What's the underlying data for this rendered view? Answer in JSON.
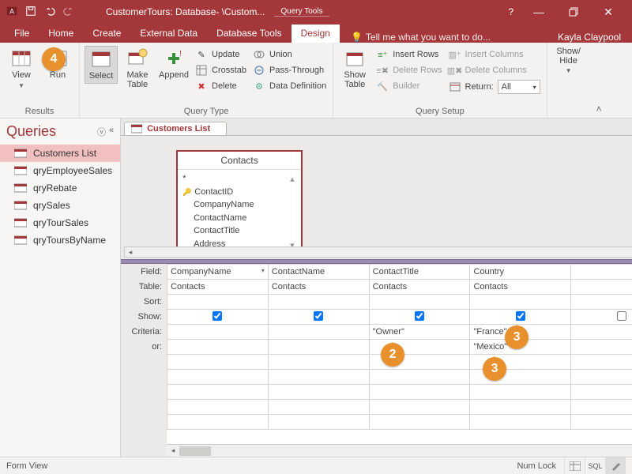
{
  "titlebar": {
    "app_title": "CustomerTours: Database- \\Custom...",
    "query_tools": "Query Tools",
    "help": "?"
  },
  "tabs": {
    "file": "File",
    "home": "Home",
    "create": "Create",
    "external": "External Data",
    "dbtools": "Database Tools",
    "design": "Design",
    "tellme": "Tell me what you want to do...",
    "user": "Kayla Claypool"
  },
  "ribbon": {
    "results": {
      "label": "Results",
      "view": "View",
      "run": "Run"
    },
    "qtype": {
      "label": "Query Type",
      "select": "Select",
      "maketable": "Make\nTable",
      "append": "Append",
      "update": "Update",
      "crosstab": "Crosstab",
      "delete": "Delete",
      "union": "Union",
      "passthrough": "Pass-Through",
      "datadef": "Data Definition"
    },
    "setup": {
      "label": "Query Setup",
      "showtable": "Show\nTable",
      "insrows": "Insert Rows",
      "delrows": "Delete Rows",
      "builder": "Builder",
      "inscols": "Insert Columns",
      "delcols": "Delete Columns",
      "return": "Return:",
      "return_val": "All"
    },
    "showhide": {
      "label": "Show/\nHide"
    }
  },
  "nav": {
    "title": "Queries",
    "items": [
      "Customers List",
      "qryEmployeeSales",
      "qryRebate",
      "qrySales",
      "qryTourSales",
      "qryToursByName"
    ]
  },
  "doc": {
    "tab": "Customers List",
    "fieldlist": {
      "title": "Contacts",
      "star": "*",
      "fields": [
        "ContactID",
        "CompanyName",
        "ContactName",
        "ContactTitle",
        "Address"
      ]
    },
    "rowlabels": [
      "Field:",
      "Table:",
      "Sort:",
      "Show:",
      "Criteria:",
      "or:"
    ],
    "cols": [
      {
        "field": "CompanyName",
        "table": "Contacts",
        "crit": "",
        "or": ""
      },
      {
        "field": "ContactName",
        "table": "Contacts",
        "crit": "",
        "or": ""
      },
      {
        "field": "ContactTitle",
        "table": "Contacts",
        "crit": "\"Owner\"",
        "or": ""
      },
      {
        "field": "Country",
        "table": "Contacts",
        "crit": "\"France\"",
        "or": "\"Mexico\""
      }
    ]
  },
  "status": {
    "left": "Form View",
    "numlock": "Num Lock",
    "sql": "SQL"
  },
  "callouts": {
    "c2": "2",
    "c3a": "3",
    "c3b": "3",
    "c4": "4"
  }
}
